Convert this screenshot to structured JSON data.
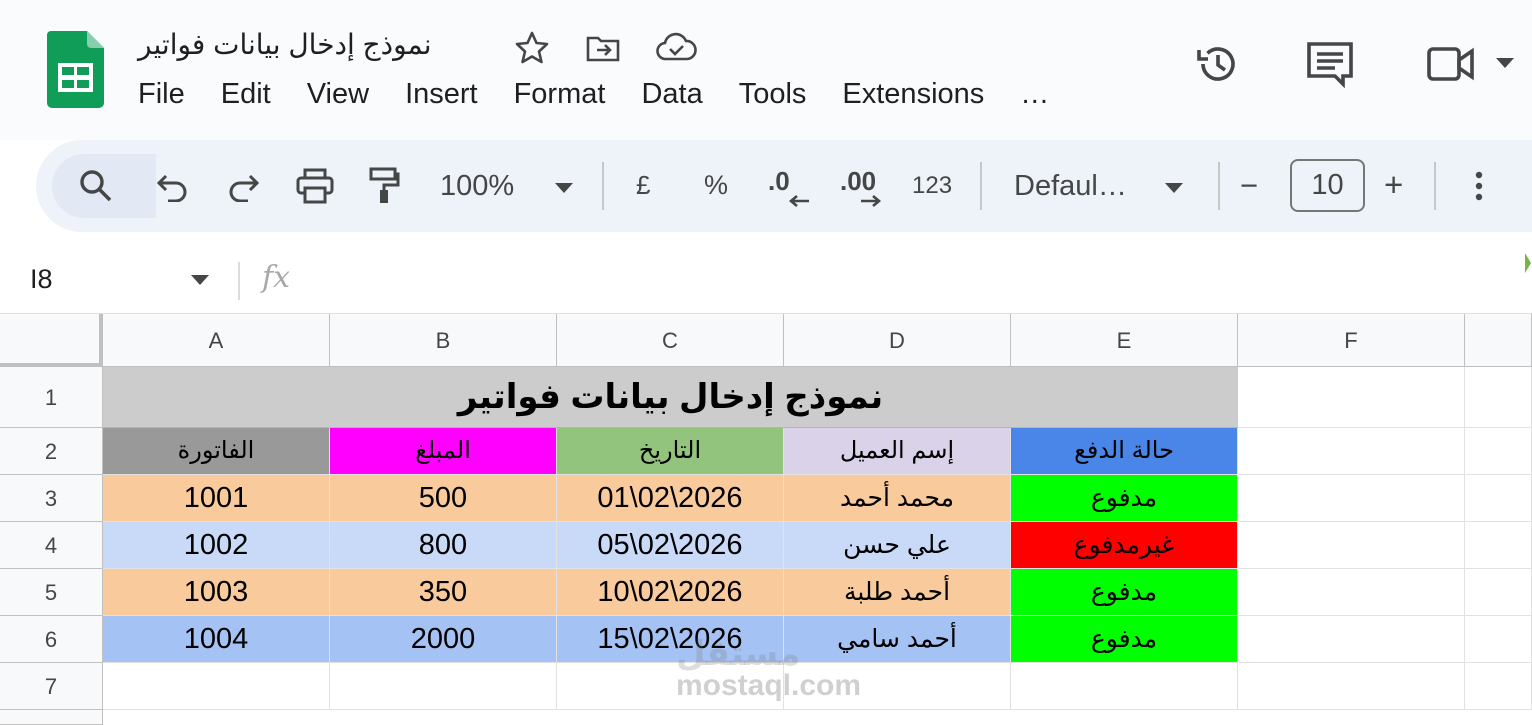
{
  "app": {
    "doc_title": "نموذج إدخال بيانات فواتير",
    "menu": [
      "File",
      "Edit",
      "View",
      "Insert",
      "Format",
      "Data",
      "Tools",
      "Extensions",
      "…"
    ]
  },
  "toolbar": {
    "zoom": "100%",
    "currency": "£",
    "percent": "%",
    "dec_decrease": ".0",
    "dec_increase": ".00",
    "number_format": "123",
    "font": "Defaul…",
    "font_size": "10",
    "minus": "−",
    "plus": "+"
  },
  "formula_bar": {
    "cell_ref": "I8",
    "fx": "fx"
  },
  "columns": [
    "A",
    "B",
    "C",
    "D",
    "E",
    "F"
  ],
  "rows": [
    "1",
    "2",
    "3",
    "4",
    "5",
    "6",
    "7"
  ],
  "sheet": {
    "title": "نموذج إدخال بيانات فواتير",
    "headers": [
      "الفاتورة",
      "المبلغ",
      "التاريخ",
      "إسم العميل",
      "حالة الدفع"
    ],
    "records": [
      {
        "invoice": "1001",
        "amount": "500",
        "date": "01\\02\\2026",
        "client": "محمد أحمد",
        "status": "مدفوع"
      },
      {
        "invoice": "1002",
        "amount": "800",
        "date": "05\\02\\2026",
        "client": "علي حسن",
        "status": "غيرمدفوع"
      },
      {
        "invoice": "1003",
        "amount": "350",
        "date": "10\\02\\2026",
        "client": "أحمد طلبة",
        "status": "مدفوع"
      },
      {
        "invoice": "1004",
        "amount": "2000",
        "date": "15\\02\\2026",
        "client": "أحمد سامي",
        "status": "مدفوع"
      }
    ]
  },
  "colors": {
    "header_a": "#999999",
    "header_b": "#ff00ff",
    "header_c": "#93c47d",
    "header_d": "#d9d2e9",
    "header_e": "#4a86e8",
    "row_orange": "#f9cb9c",
    "row_blue_light": "#c9daf8",
    "row_blue": "#a4c2f4",
    "paid": "#00ff00",
    "unpaid": "#ff0000"
  },
  "watermark": {
    "arabic": "مستقل",
    "latin": "mostaql.com"
  }
}
